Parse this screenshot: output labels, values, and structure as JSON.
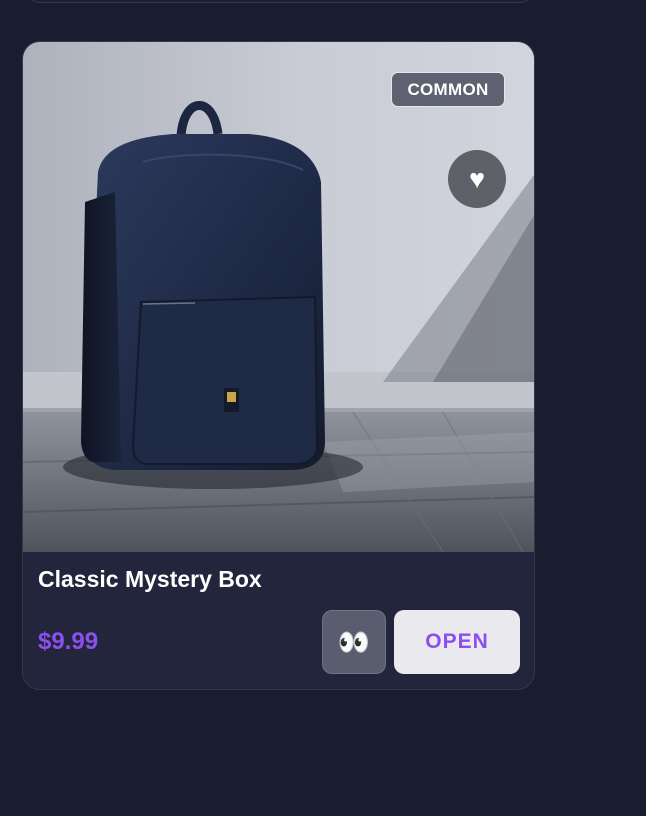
{
  "card": {
    "rarity": "COMMON",
    "favorite_icon": "♥",
    "title": "Classic Mystery Box",
    "price": "$9.99",
    "peek_icon": "👀",
    "open_label": "OPEN"
  },
  "colors": {
    "background": "#1a1d30",
    "card_background": "#22253b",
    "accent_purple": "#8b4ff0",
    "badge_background": "#5d6170"
  },
  "icons": {
    "favorite": "heart-icon",
    "peek": "eyes-icon",
    "product": "backpack-image"
  }
}
